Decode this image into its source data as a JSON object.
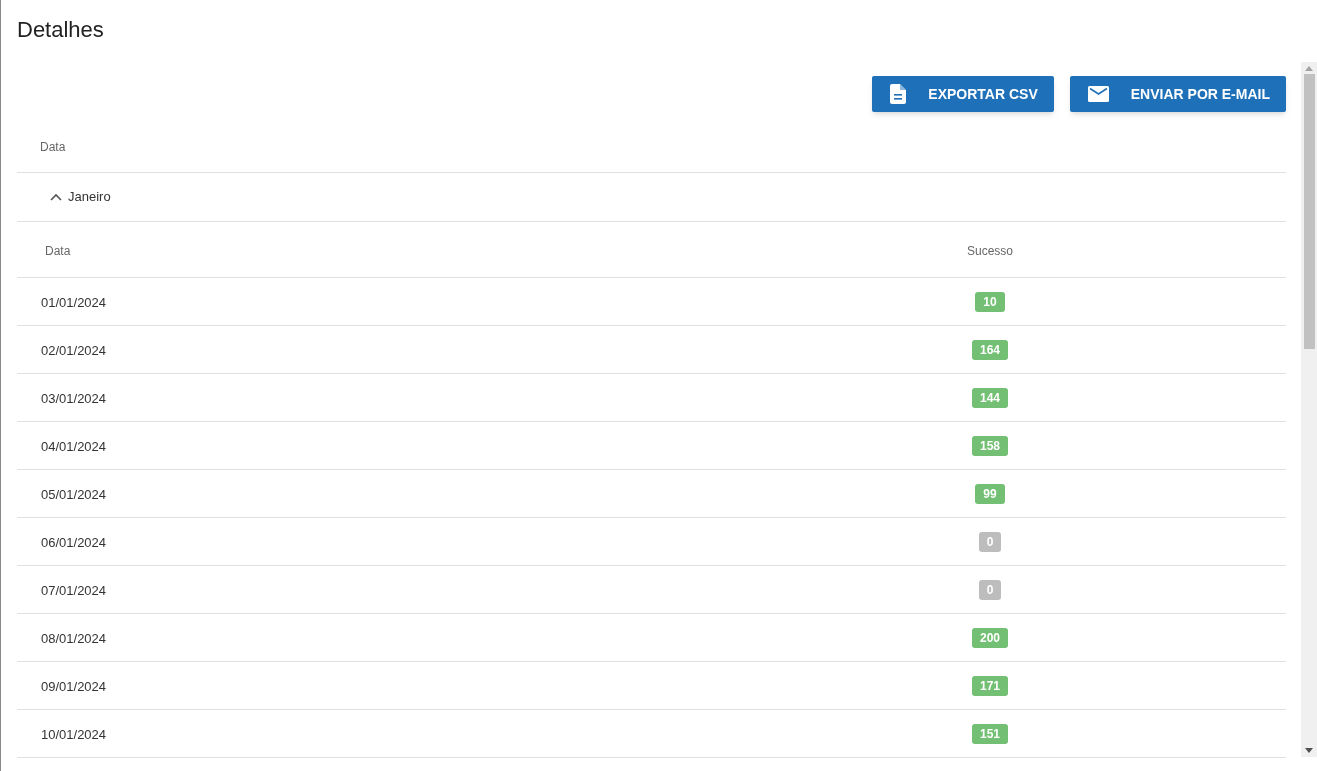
{
  "title": "Detalhes",
  "buttons": [
    {
      "kind": "file",
      "label": "EXPORTAR CSV"
    },
    {
      "kind": "mail",
      "label": "ENVIAR POR E-MAIL"
    }
  ],
  "table": {
    "column": "Data",
    "group": {
      "label": "Janeiro",
      "expanded": true,
      "columns": [
        "Data",
        "Sucesso"
      ],
      "rows": [
        {
          "date": "01/01/2024",
          "sucesso": "10",
          "color": "#73bf73"
        },
        {
          "date": "02/01/2024",
          "sucesso": "164",
          "color": "#73bf73"
        },
        {
          "date": "03/01/2024",
          "sucesso": "144",
          "color": "#73bf73"
        },
        {
          "date": "04/01/2024",
          "sucesso": "158",
          "color": "#73bf73"
        },
        {
          "date": "05/01/2024",
          "sucesso": "99",
          "color": "#73bf73"
        },
        {
          "date": "06/01/2024",
          "sucesso": "0",
          "color": "#bdbdbd"
        },
        {
          "date": "07/01/2024",
          "sucesso": "0",
          "color": "#bdbdbd"
        },
        {
          "date": "08/01/2024",
          "sucesso": "200",
          "color": "#73bf73"
        },
        {
          "date": "09/01/2024",
          "sucesso": "171",
          "color": "#73bf73"
        },
        {
          "date": "10/01/2024",
          "sucesso": "151",
          "color": "#73bf73"
        }
      ]
    }
  }
}
